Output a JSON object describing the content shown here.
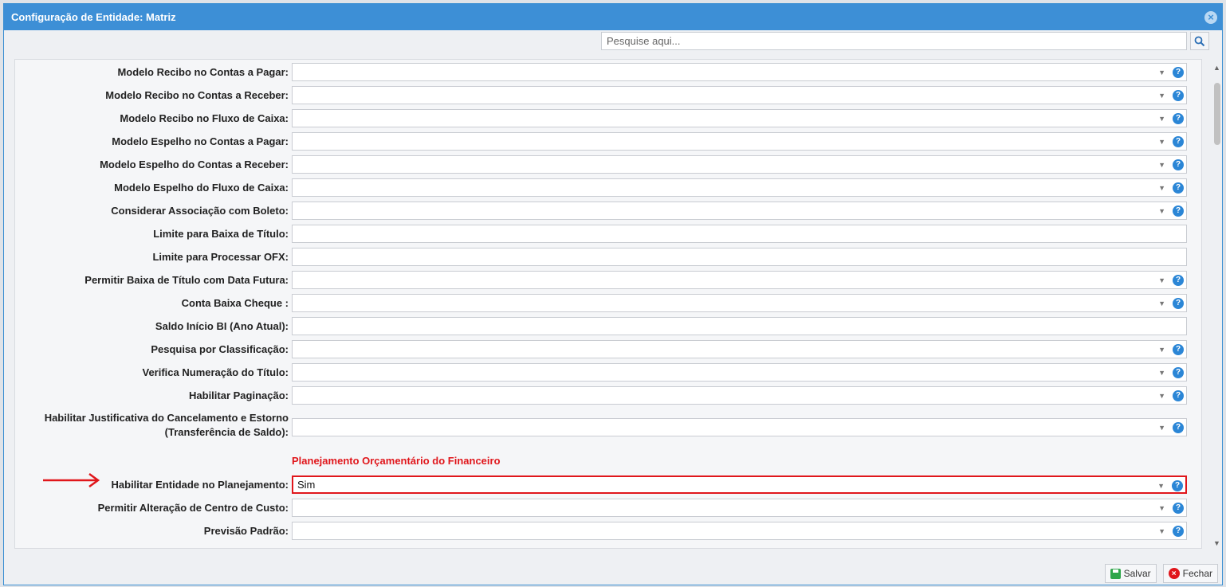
{
  "window": {
    "title": "Configuração de Entidade: Matriz",
    "close_icon": "close-icon"
  },
  "search": {
    "placeholder": "Pesquise aqui...",
    "icon": "search-icon"
  },
  "rows": [
    {
      "label": "Modelo Recibo no Contas a Pagar:",
      "value": "",
      "type": "select"
    },
    {
      "label": "Modelo Recibo no Contas a Receber:",
      "value": "",
      "type": "select"
    },
    {
      "label": "Modelo Recibo no Fluxo de Caixa:",
      "value": "",
      "type": "select"
    },
    {
      "label": "Modelo Espelho no Contas a Pagar:",
      "value": "",
      "type": "select"
    },
    {
      "label": "Modelo Espelho do Contas a Receber:",
      "value": "",
      "type": "select"
    },
    {
      "label": "Modelo Espelho do Fluxo de Caixa:",
      "value": "",
      "type": "select"
    },
    {
      "label": "Considerar Associação com Boleto:",
      "value": "",
      "type": "select"
    },
    {
      "label": "Limite para Baixa de Título:",
      "value": "",
      "type": "text"
    },
    {
      "label": "Limite para Processar OFX:",
      "value": "",
      "type": "text"
    },
    {
      "label": "Permitir Baixa de Título com Data Futura:",
      "value": "",
      "type": "select"
    },
    {
      "label": "Conta Baixa Cheque :",
      "value": "",
      "type": "select"
    },
    {
      "label": "Saldo Início BI (Ano Atual):",
      "value": "",
      "type": "text"
    },
    {
      "label": "Pesquisa por Classificação:",
      "value": "",
      "type": "select"
    },
    {
      "label": "Verifica Numeração do Título:",
      "value": "",
      "type": "select"
    },
    {
      "label": "Habilitar Paginação:",
      "value": "",
      "type": "select"
    },
    {
      "label_line1": "Habilitar Justificativa do Cancelamento e Estorno",
      "label_line2": "(Transferência de Saldo):",
      "value": "",
      "type": "select"
    }
  ],
  "section": {
    "title": "Planejamento Orçamentário do Financeiro"
  },
  "planning_rows": [
    {
      "label": "Habilitar Entidade no Planejamento:",
      "value": "Sim",
      "type": "select"
    },
    {
      "label": "Permitir Alteração de Centro de Custo:",
      "value": "",
      "type": "select"
    },
    {
      "label": "Previsão Padrão:",
      "value": "",
      "type": "select"
    }
  ],
  "footer": {
    "save_label": "Salvar",
    "close_label": "Fechar"
  },
  "colors": {
    "titlebar": "#3d8fd6",
    "highlight": "#e0161b",
    "help": "#2b86d6"
  }
}
